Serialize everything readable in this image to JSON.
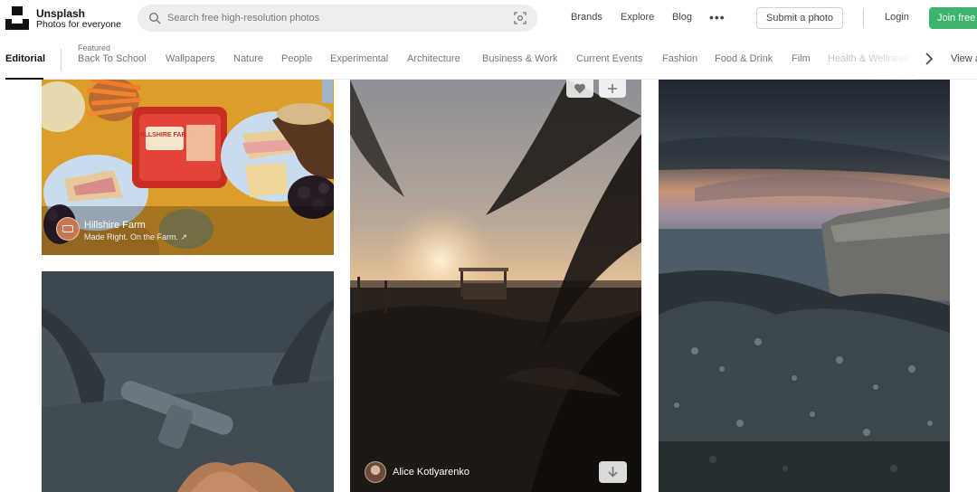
{
  "header": {
    "brand_name": "Unsplash",
    "brand_tagline": "Photos for everyone",
    "search_placeholder": "Search free high-resolution photos",
    "nav": [
      "Brands",
      "Explore",
      "Blog"
    ],
    "more_icon": "more-dots-icon",
    "submit_label": "Submit a photo",
    "login_label": "Login",
    "join_label": "Join free",
    "join_color": "#3cb46e"
  },
  "topics": {
    "active": "Editorial",
    "featured_label": "Featured",
    "items": [
      "Back To School",
      "Wallpapers",
      "Nature",
      "People",
      "Experimental",
      "Architecture",
      "Business & Work",
      "Current Events",
      "Fashion",
      "Food & Drink",
      "Film",
      "Health & Wellness"
    ],
    "view_all": "View all",
    "next_icon": "chevron-right-icon"
  },
  "photos": {
    "sponsored": {
      "name": "Hillshire Farm",
      "tagline": "Made Right. On the Farm. ↗",
      "package_text": "HILLSHIRE FARM"
    },
    "featured": {
      "author": "Alice Kotlyarenko",
      "like_icon": "heart-icon",
      "collect_icon": "plus-icon",
      "download_icon": "download-arrow-icon"
    }
  }
}
